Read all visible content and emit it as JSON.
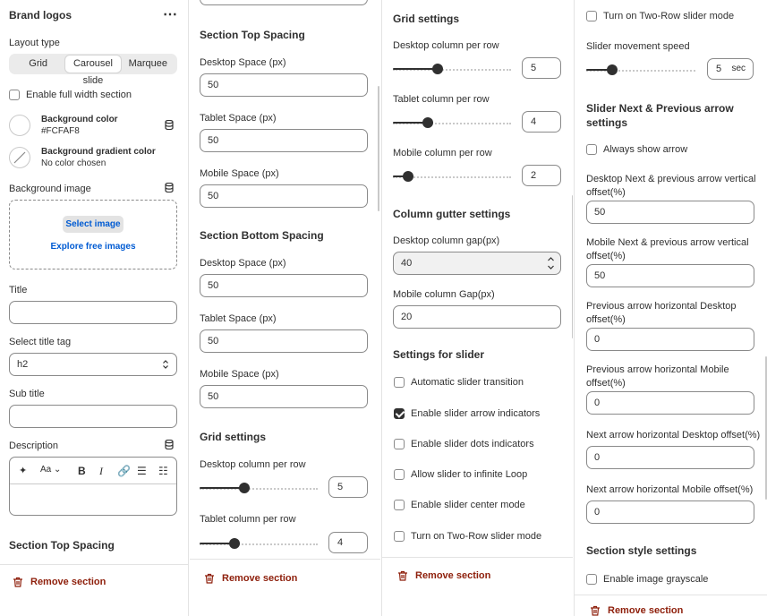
{
  "panel1": {
    "title": "Brand logos",
    "more_icon": "⋯",
    "layout_type_label": "Layout type",
    "layout_options": [
      "Grid",
      "Carousel slide",
      "Marquee"
    ],
    "layout_selected": "Carousel slide",
    "full_width_label": "Enable full width section",
    "bg_color_label": "Background color",
    "bg_color_value": "#FCFAF8",
    "bg_gradient_label": "Background gradient color",
    "bg_gradient_value": "No color chosen",
    "bg_image_label": "Background image",
    "select_image": "Select image",
    "explore_images": "Explore free images",
    "title_label": "Title",
    "title_value": "",
    "title_tag_label": "Select title tag",
    "title_tag_value": "h2",
    "subtitle_label": "Sub title",
    "subtitle_value": "",
    "description_label": "Description",
    "section_top_spacing": "Section Top Spacing",
    "remove": "Remove section"
  },
  "panel2": {
    "top_spacing": "Section Top Spacing",
    "top_desktop_label": "Desktop Space (px)",
    "top_desktop_value": "50",
    "top_tablet_label": "Tablet Space (px)",
    "top_tablet_value": "50",
    "top_mobile_label": "Mobile Space (px)",
    "top_mobile_value": "50",
    "bottom_spacing": "Section Bottom Spacing",
    "bottom_desktop_label": "Desktop Space (px)",
    "bottom_desktop_value": "50",
    "bottom_tablet_label": "Tablet Space (px)",
    "bottom_tablet_value": "50",
    "bottom_mobile_label": "Mobile Space (px)",
    "bottom_mobile_value": "50",
    "grid_settings": "Grid settings",
    "desktop_col_label": "Desktop column per row",
    "desktop_col_value": "5",
    "tablet_col_label": "Tablet column per row",
    "tablet_col_value": "4",
    "remove": "Remove section"
  },
  "panel3": {
    "grid_settings": "Grid settings",
    "desktop_col_label": "Desktop column per row",
    "desktop_col_value": "5",
    "tablet_col_label": "Tablet column per row",
    "tablet_col_value": "4",
    "mobile_col_label": "Mobile column per row",
    "mobile_col_value": "2",
    "gutter_settings": "Column gutter settings",
    "desktop_gap_label": "Desktop column gap(px)",
    "desktop_gap_value": "40",
    "mobile_gap_label": "Mobile column Gap(px)",
    "mobile_gap_value": "20",
    "slider_settings": "Settings for slider",
    "auto_transition": "Automatic slider transition",
    "arrow_indicators": "Enable slider arrow indicators",
    "dots_indicators": "Enable slider dots indicators",
    "infinite_loop": "Allow slider to infinite Loop",
    "center_mode": "Enable slider center mode",
    "two_row": "Turn on Two-Row slider mode",
    "remove": "Remove section"
  },
  "panel4": {
    "two_row": "Turn on Two-Row slider mode",
    "speed_label": "Slider movement speed",
    "speed_value": "5",
    "speed_unit": "sec",
    "arrow_heading": "Slider Next & Previous arrow settings",
    "always_show": "Always show arrow",
    "desk_vert_label": "Desktop Next & previous arrow vertical offset(%)",
    "desk_vert_value": "50",
    "mob_vert_label": "Mobile Next & previous arrow vertical offset(%)",
    "mob_vert_value": "50",
    "prev_desk_label": "Previous arrow horizontal Desktop offset(%)",
    "prev_desk_value": "0",
    "prev_mob_label": "Previous arrow horizontal Mobile offset(%)",
    "prev_mob_value": "0",
    "next_desk_label": "Next arrow horizontal Desktop offset(%)",
    "next_desk_value": "0",
    "next_mob_label": "Next arrow horizontal Mobile offset(%)",
    "next_mob_value": "0",
    "style_settings": "Section style settings",
    "grayscale": "Enable image grayscale",
    "remove": "Remove section"
  },
  "sliders": {
    "p2_desktop_cols": 5,
    "p2_tablet_cols": 4,
    "p3_desktop_cols": 5,
    "p3_tablet_cols": 4,
    "p3_mobile_cols": 2,
    "p4_speed": 5
  },
  "checkbox_states": {
    "full_width": false,
    "auto_transition": false,
    "arrow_indicators": true,
    "dots_indicators": false,
    "infinite_loop": false,
    "center_mode": false,
    "two_row_p3": false,
    "two_row_p4": false,
    "always_show": false,
    "grayscale": false
  },
  "colors": {
    "danger": "#8e1f0b",
    "link": "#005bd3",
    "ink": "#303030"
  }
}
